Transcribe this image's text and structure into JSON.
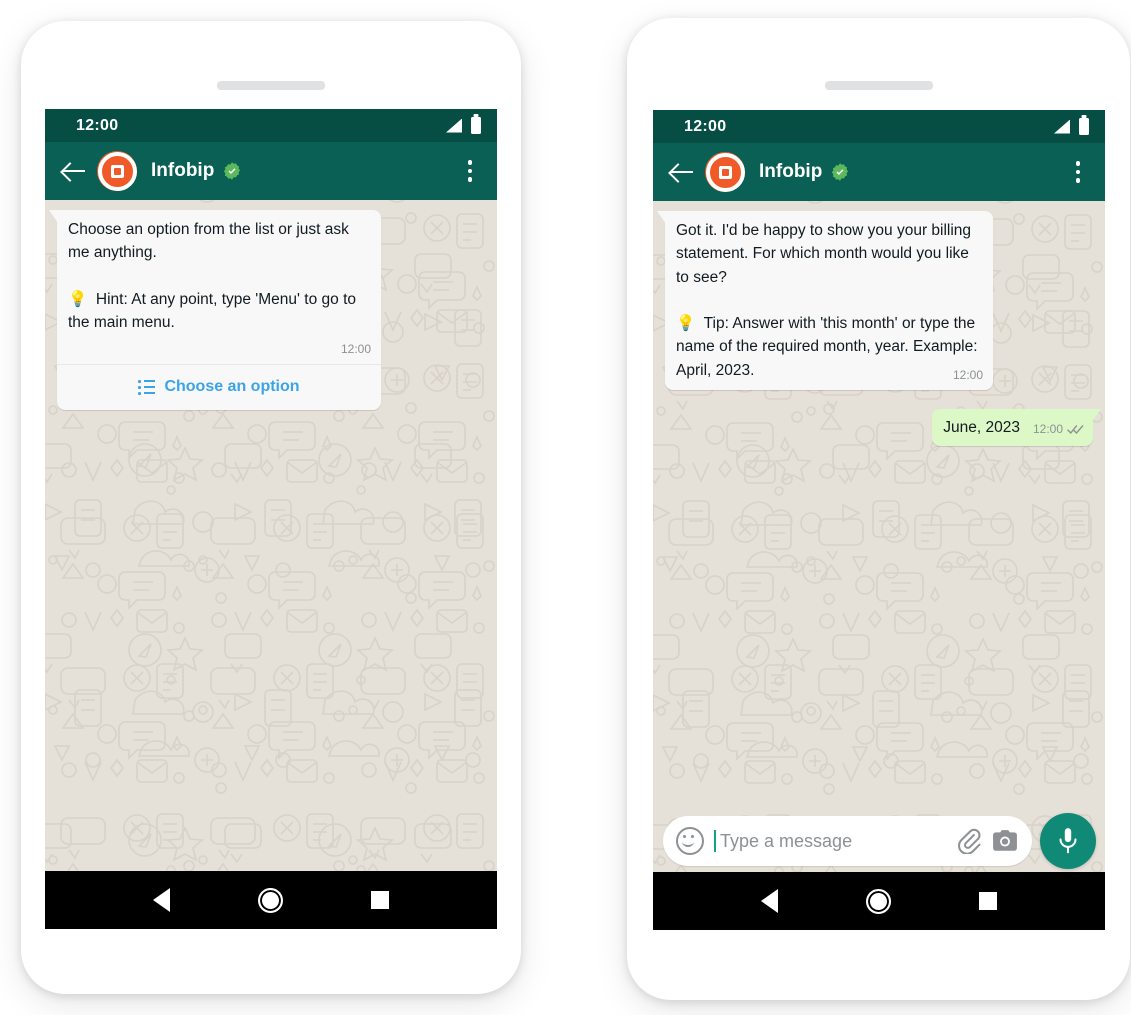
{
  "app": {
    "name": "WhatsApp",
    "accent_teal": "#0a6054",
    "statusbar_color": "#064e44",
    "incoming_bubble_color": "#f7f8f7",
    "outgoing_bubble_color": "#dcf8c6",
    "link_color": "#3ba4e8",
    "brand_orange": "#f05a28",
    "chat_background_color": "#e5e0d8",
    "mic_button_color": "#108a76"
  },
  "phones": [
    {
      "id": "left",
      "statusbar": {
        "time": "12:00",
        "signal_icon": "signal-icon",
        "battery_icon": "battery-icon"
      },
      "header": {
        "back_icon": "back-arrow-icon",
        "avatar_icon": "infobip-avatar",
        "contact_name": "Infobip",
        "verified_icon": "verified-badge-icon",
        "menu_icon": "overflow-menu-icon"
      },
      "messages": [
        {
          "direction": "incoming",
          "text": "Choose an option from the list or just ask me anything.\n\n💡  Hint: At any point, type 'Menu' to go to the main menu.",
          "time": "12:00",
          "button": {
            "icon": "list-icon",
            "label": "Choose an option"
          }
        }
      ],
      "navbar": {
        "back_icon": "nav-back-icon",
        "home_icon": "nav-home-icon",
        "recent_icon": "nav-recent-icon"
      }
    },
    {
      "id": "right",
      "statusbar": {
        "time": "12:00",
        "signal_icon": "signal-icon",
        "battery_icon": "battery-icon"
      },
      "header": {
        "back_icon": "back-arrow-icon",
        "avatar_icon": "infobip-avatar",
        "contact_name": "Infobip",
        "verified_icon": "verified-badge-icon",
        "menu_icon": "overflow-menu-icon"
      },
      "messages": [
        {
          "direction": "incoming",
          "text": "Got it. I'd be happy to show you your billing statement. For which month would you like to see?\n\n💡  Tip: Answer with 'this month' or type the name of the required month, year. Example: April, 2023.",
          "time": "12:00"
        },
        {
          "direction": "outgoing",
          "text": "June, 2023",
          "time": "12:00",
          "status_icon": "double-check-icon"
        }
      ],
      "composer": {
        "emoji_icon": "emoji-icon",
        "placeholder": "Type a message",
        "value": "",
        "attach_icon": "paperclip-icon",
        "camera_icon": "camera-icon",
        "mic_icon": "microphone-icon"
      },
      "navbar": {
        "back_icon": "nav-back-icon",
        "home_icon": "nav-home-icon",
        "recent_icon": "nav-recent-icon"
      }
    }
  ]
}
